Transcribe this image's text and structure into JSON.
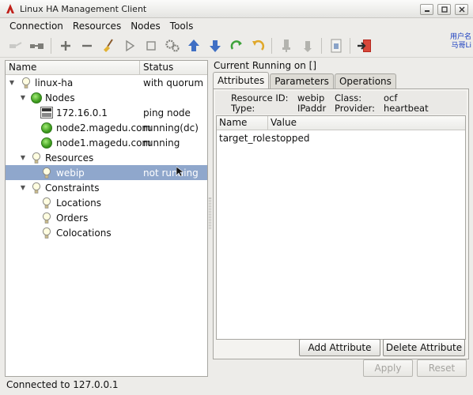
{
  "window": {
    "title": "Linux HA Management Client"
  },
  "menu": [
    "Connection",
    "Resources",
    "Nodes",
    "Tools"
  ],
  "toolbar_overlay": {
    "line1": "用户名",
    "line2": "马哥Li"
  },
  "tree": {
    "headers": {
      "name": "Name",
      "status": "Status"
    },
    "rows": [
      {
        "label": "linux-ha",
        "status": "with quorum"
      },
      {
        "label": "Nodes",
        "status": ""
      },
      {
        "label": "172.16.0.1",
        "status": "ping node"
      },
      {
        "label": "node2.magedu.com",
        "status": "running(dc)"
      },
      {
        "label": "node1.magedu.com",
        "status": "running"
      },
      {
        "label": "Resources",
        "status": ""
      },
      {
        "label": "webip",
        "status": "not running"
      },
      {
        "label": "Constraints",
        "status": ""
      },
      {
        "label": "Locations",
        "status": ""
      },
      {
        "label": "Orders",
        "status": ""
      },
      {
        "label": "Colocations",
        "status": ""
      }
    ]
  },
  "right": {
    "title": "Current Running on []",
    "tabs": [
      "Attributes",
      "Parameters",
      "Operations"
    ],
    "info": {
      "resource_id_label": "Resource ID:",
      "resource_id": "webip",
      "type_label": "Type:",
      "type": "IPaddr",
      "class_label": "Class:",
      "class": "ocf",
      "provider_label": "Provider:",
      "provider": "heartbeat"
    },
    "table": {
      "headers": {
        "name": "Name",
        "value": "Value"
      },
      "rows": [
        {
          "name": "target_role",
          "value": "stopped"
        }
      ]
    },
    "buttons": {
      "add": "Add Attribute",
      "delete": "Delete Attribute",
      "apply": "Apply",
      "reset": "Reset"
    }
  },
  "status": "Connected to 127.0.0.1"
}
